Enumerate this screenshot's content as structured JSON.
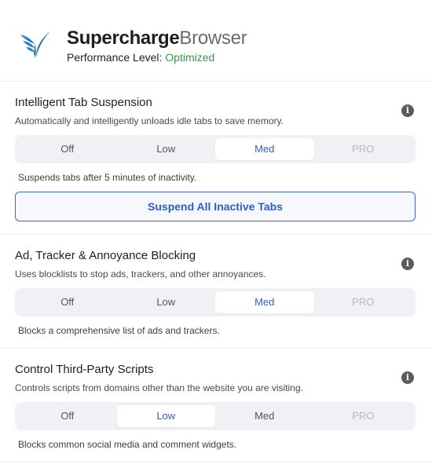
{
  "header": {
    "brand_bold": "Supercharge",
    "brand_light": "Browser",
    "perf_label": "Performance Level: ",
    "perf_value": "Optimized",
    "perf_value_color": "#2e9e4a",
    "logo_icon": "bird-wings-logo"
  },
  "options": [
    "Off",
    "Low",
    "Med",
    "PRO"
  ],
  "sections": [
    {
      "title": "Intelligent Tab Suspension",
      "description": "Automatically and intelligently unloads idle tabs to save memory.",
      "selected": "Med",
      "note": "Suspends tabs after 5 minutes of inactivity.",
      "button": "Suspend All Inactive Tabs"
    },
    {
      "title": "Ad, Tracker & Annoyance Blocking",
      "description": "Uses blocklists to stop ads, trackers, and other annoyances.",
      "selected": "Med",
      "note": "Blocks a comprehensive list of ads and trackers."
    },
    {
      "title": "Control Third-Party Scripts",
      "description": "Controls scripts from domains other than the website you are visiting.",
      "selected": "Low",
      "note": "Blocks common social media and comment widgets."
    }
  ],
  "colors": {
    "accent": "#2a5fc7",
    "segment_bg": "#f0f1f4",
    "pro_disabled": "#b8b8b8",
    "info_icon": "#5b5b5b"
  }
}
